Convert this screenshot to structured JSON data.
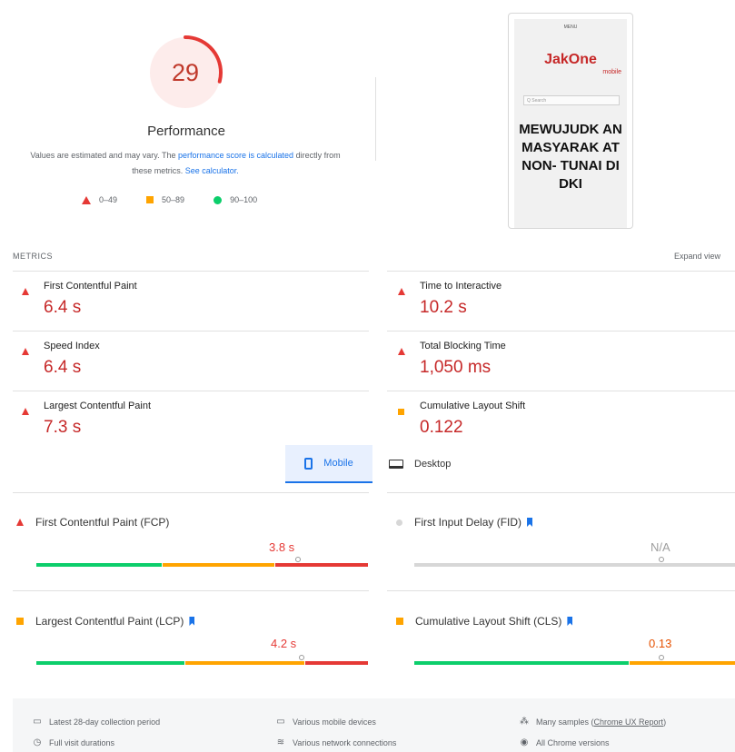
{
  "summary": {
    "score": "29",
    "score_fraction": 0.29,
    "title": "Performance",
    "note_prefix": "Values are estimated and may vary. The ",
    "note_link1": "performance score is calculated",
    "note_middle": " directly from these metrics. ",
    "note_link2": "See calculator.",
    "legend": [
      {
        "shape": "triangle",
        "label": "0–49",
        "color": "#e53935"
      },
      {
        "shape": "square",
        "label": "50–89",
        "color": "#ffa400"
      },
      {
        "shape": "circle",
        "label": "90–100",
        "color": "#0cce6b"
      }
    ]
  },
  "screenshot": {
    "menu": "MENU",
    "logo": "JakOne",
    "logo_sub": "mobile",
    "search_placeholder": "Q Search",
    "headline": "MEWUJUDK AN MASYARAK AT NON- TUNAI DI DKI"
  },
  "metrics": {
    "label": "METRICS",
    "expand": "Expand view",
    "items": [
      {
        "title": "First Contentful Paint",
        "value": "6.4 s",
        "status": "red"
      },
      {
        "title": "Time to Interactive",
        "value": "10.2 s",
        "status": "red"
      },
      {
        "title": "Speed Index",
        "value": "6.4 s",
        "status": "red"
      },
      {
        "title": "Total Blocking Time",
        "value": "1,050 ms",
        "status": "red"
      },
      {
        "title": "Largest Contentful Paint",
        "value": "7.3 s",
        "status": "red"
      },
      {
        "title": "Cumulative Layout Shift",
        "value": "0.122",
        "status": "orange"
      }
    ]
  },
  "tabs": {
    "mobile": "Mobile",
    "desktop": "Desktop"
  },
  "field": [
    {
      "title": "First Contentful Paint (FCP)",
      "value": "3.8 s",
      "status": "red",
      "bookmark": false,
      "segments": [
        0.38,
        0.34,
        0.28
      ],
      "marker": 0.79
    },
    {
      "title": "First Input Delay (FID)",
      "value": "N/A",
      "status": "grey",
      "bookmark": true,
      "segments": [
        1.0
      ],
      "marker": 0.77
    },
    {
      "title": "Largest Contentful Paint (LCP)",
      "value": "4.2 s",
      "status": "orange",
      "bookmark": true,
      "segments": [
        0.45,
        0.36,
        0.19
      ],
      "marker": 0.8
    },
    {
      "title": "Cumulative Layout Shift (CLS)",
      "value": "0.13",
      "status": "orange",
      "bookmark": true,
      "segments": [
        0.67,
        0.33
      ],
      "marker": 0.77
    }
  ],
  "footer": [
    {
      "icon": "calendar-icon",
      "glyph": "▭",
      "text": "Latest 28-day collection period"
    },
    {
      "icon": "devices-icon",
      "glyph": "▭",
      "text": "Various mobile devices"
    },
    {
      "icon": "samples-icon",
      "glyph": "⁂",
      "text": "Many samples",
      "link": "Chrome UX Report"
    },
    {
      "icon": "timer-icon",
      "glyph": "◷",
      "text": "Full visit durations"
    },
    {
      "icon": "wifi-icon",
      "glyph": "≋",
      "text": "Various network connections"
    },
    {
      "icon": "chrome-icon",
      "glyph": "◉",
      "text": "All Chrome versions"
    }
  ],
  "colors": {
    "red": "#e53935",
    "orange": "#ffa400",
    "green": "#0cce6b",
    "grey": "#d7d7d7",
    "accent": "#1a73e8"
  }
}
